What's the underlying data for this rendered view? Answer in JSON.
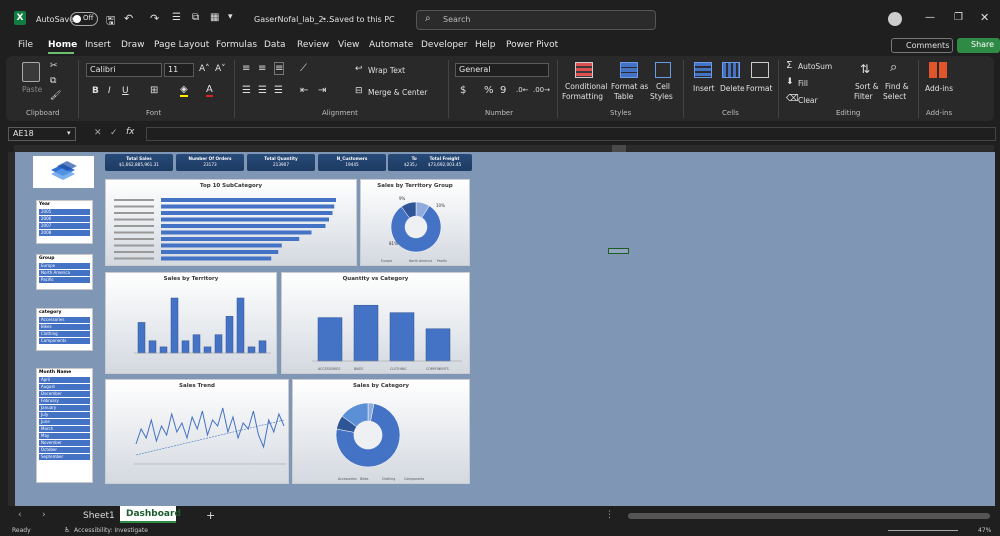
{
  "titlebar": {
    "autosave": "AutoSave",
    "toggle": "Off",
    "filename": "GaserNofal_lab_2....",
    "saved": "• Saved to this PC",
    "search_placeholder": "Search"
  },
  "menu": [
    "File",
    "Home",
    "Insert",
    "Draw",
    "Page Layout",
    "Formulas",
    "Data",
    "Review",
    "View",
    "Automate",
    "Developer",
    "Help",
    "Power Pivot"
  ],
  "menu_right": {
    "comments": "Comments",
    "share": "Share"
  },
  "ribbon": {
    "clipboard": {
      "paste": "Paste",
      "label": "Clipboard"
    },
    "font": {
      "name": "Calibri",
      "size": "11",
      "label": "Font"
    },
    "alignment": {
      "wrap": "Wrap Text",
      "merge": "Merge & Center",
      "label": "Alignment"
    },
    "number": {
      "format": "General",
      "label": "Number"
    },
    "styles": {
      "cond": [
        "Conditional",
        "Formatting"
      ],
      "table": [
        "Format as",
        "Table"
      ],
      "cell": [
        "Cell",
        "Styles"
      ],
      "label": "Styles"
    },
    "cells": {
      "insert": "Insert",
      "delete": "Delete",
      "format": "Format",
      "label": "Cells"
    },
    "editing": {
      "autosum": "AutoSum",
      "fill": "Fill",
      "clear": "Clear",
      "sort": [
        "Sort &",
        "Filter"
      ],
      "find": [
        "Find &",
        "Select"
      ],
      "label": "Editing"
    },
    "addins": {
      "name": "Add-ins",
      "label": "Add-ins"
    }
  },
  "formula": {
    "namebox": "AE18",
    "fx": "fx"
  },
  "kpis": [
    {
      "label": "Total Sales",
      "value": "$1,662,885,961.31"
    },
    {
      "label": "Number Of Orders",
      "value": "23173"
    },
    {
      "label": "Total Quantity",
      "value": "213907"
    },
    {
      "label": "N_Customers",
      "value": "19445"
    },
    {
      "label": "Total Tax",
      "value": "$235,414,464.69"
    },
    {
      "label": "Total Freight",
      "value": "$73,692,003.45"
    }
  ],
  "slicers": {
    "year": {
      "title": "Year",
      "items": [
        "2005",
        "2006",
        "2007",
        "2008"
      ]
    },
    "group": {
      "title": "Group",
      "items": [
        "Europe",
        "North America",
        "Pacific"
      ]
    },
    "category": {
      "title": "category",
      "items": [
        "Accessories",
        "Bikes",
        "Clothing",
        "Components"
      ]
    },
    "month": {
      "title": "Month Name",
      "items": [
        "April",
        "August",
        "December",
        "February",
        "January",
        "July",
        "June",
        "March",
        "May",
        "November",
        "October",
        "September"
      ]
    }
  },
  "chart_data": [
    {
      "type": "bar",
      "title": "Top 10 SubCategory",
      "orientation": "horizontal",
      "categories": [
        "Item 1",
        "Item 2",
        "Item 3",
        "Item 4",
        "Item 5",
        "Item 6",
        "Item 7",
        "Item 8",
        "Item 9",
        "Item 10"
      ],
      "values": [
        100,
        99,
        98,
        96,
        94,
        86,
        79,
        69,
        67,
        63
      ]
    },
    {
      "type": "pie",
      "title": "Sales by Territory Group",
      "donut": true,
      "categories": [
        "Europe",
        "North America",
        "Pacific"
      ],
      "values": [
        9,
        82,
        10
      ],
      "data_labels": [
        "9%",
        "10%",
        "81%"
      ]
    },
    {
      "type": "bar",
      "title": "Sales by Territory",
      "values": [
        5,
        2,
        1,
        9,
        2,
        3,
        1,
        3,
        6,
        9,
        1,
        2
      ]
    },
    {
      "type": "bar",
      "title": "Quantity vs Category",
      "categories": [
        "ACCESSORIES",
        "BIKES",
        "CLOTHING",
        "COMPONENTS"
      ],
      "values": [
        70,
        90,
        78,
        52
      ]
    },
    {
      "type": "line",
      "title": "Sales Trend",
      "values": [
        30,
        55,
        40,
        70,
        35,
        60,
        45,
        80,
        50,
        65,
        40,
        75,
        55,
        85,
        45,
        70,
        60,
        90,
        50,
        75,
        40,
        65,
        55,
        85,
        45,
        25,
        70,
        50,
        80,
        60
      ]
    },
    {
      "type": "pie",
      "title": "Sales by Category",
      "donut": true,
      "categories": [
        "Accessories",
        "Bikes",
        "Clothing",
        "Components"
      ],
      "values": [
        3,
        75,
        7,
        15
      ]
    }
  ],
  "sheets": [
    "Sheet1",
    "Dashboard"
  ],
  "status": {
    "ready": "Ready",
    "accessibility": "Accessibility: Investigate",
    "zoom": "47%"
  }
}
